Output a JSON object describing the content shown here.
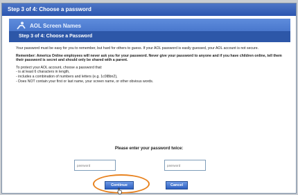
{
  "window": {
    "title": "Step 3 of 4: Choose a password"
  },
  "header": {
    "brand": "AOL Screen Names",
    "subtitle": "Step 3 of 4: Choose a Password"
  },
  "content": {
    "intro": "Your password must be easy for you to remember, but hard for others to guess. If your AOL password is easily guessed, your AOL account is not secure.",
    "warning": "Remember: America Online employees will never ask you for your password. Never give your password to anyone and if you have children online, tell them their password is secret and should only be shared with a parent.",
    "tips_heading": "To protect your AOL account, choose a password that:",
    "tips": [
      "- is at least 6 characters in length,",
      "- includes a combination of numbers and letters (e.g. 1c0l8bn2),",
      "- Does NOT contain your first or last name, your screen name, or other obvious words."
    ]
  },
  "form": {
    "prompt": "Please enter your password twice:",
    "password_placeholder": "password",
    "confirm_placeholder": "password"
  },
  "buttons": {
    "continue": "Continue",
    "cancel": "Cancel"
  },
  "colors": {
    "title_bar": "#2b56b0",
    "header_band": "#3866c0",
    "subheader": "#2d57a8",
    "button": "#2d5fc0",
    "highlight_ring": "#e8821e"
  },
  "icons": {
    "brand": "aol-running-man-icon",
    "pointer": "hand-cursor-icon"
  }
}
